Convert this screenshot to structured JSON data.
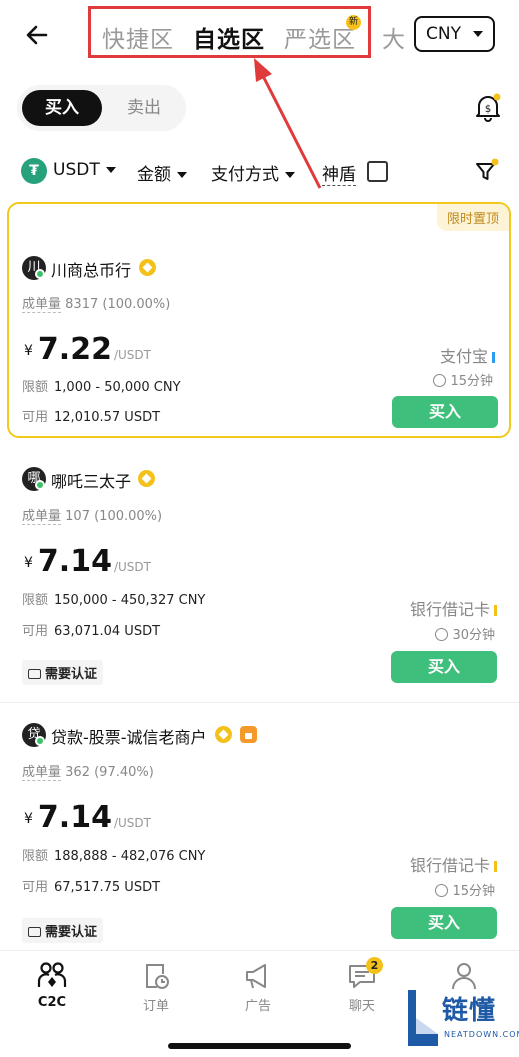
{
  "header": {
    "zone_tabs": [
      {
        "label": "快捷区"
      },
      {
        "label": "自选区"
      },
      {
        "label": "严选区"
      }
    ],
    "new_badge": "新",
    "zone_more": "大",
    "currency": "CNY"
  },
  "trade_toggle": {
    "buy": "买入",
    "sell": "卖出"
  },
  "filters": {
    "coin": "USDT",
    "coin_icon": "₮",
    "amount": "金额",
    "payment": "支付方式",
    "shield": "神盾"
  },
  "listings": [
    {
      "pinned": true,
      "pin_tag": "限时置顶",
      "avatar": "川",
      "merchant": "川商总币行",
      "trades_label": "成单量",
      "trades_value": "8317 (100.00%)",
      "yen": "¥",
      "price": "7.22",
      "unit": "/USDT",
      "limit_label": "限额",
      "limit_value": "1,000 - 50,000 CNY",
      "avail_label": "可用",
      "avail_value": "12,010.57 USDT",
      "payment": "支付宝",
      "payment_color": "#2d9cf0",
      "time": "15分钟",
      "buy": "买入"
    },
    {
      "pinned": false,
      "avatar": "哪",
      "merchant": "哪吒三太子",
      "trades_label": "成单量",
      "trades_value": "107 (100.00%)",
      "yen": "¥",
      "price": "7.14",
      "unit": "/USDT",
      "limit_label": "限额",
      "limit_value": "150,000 - 450,327 CNY",
      "avail_label": "可用",
      "avail_value": "63,071.04 USDT",
      "payment": "银行借记卡",
      "payment_color": "#f3c11a",
      "time": "30分钟",
      "kyc": "需要认证",
      "buy": "买入"
    },
    {
      "pinned": false,
      "avatar": "贷",
      "merchant": "贷款-股票-诚信老商户",
      "trades_label": "成单量",
      "trades_value": "362 (97.40%)",
      "yen": "¥",
      "price": "7.14",
      "unit": "/USDT",
      "limit_label": "限额",
      "limit_value": "188,888 - 482,076 CNY",
      "avail_label": "可用",
      "avail_value": "67,517.75 USDT",
      "payment": "银行借记卡",
      "payment_color": "#f3c11a",
      "time": "15分钟",
      "kyc": "需要认证",
      "buy": "买入"
    }
  ],
  "bottom_nav": [
    {
      "label": "C2C",
      "icon": "c2c-icon",
      "active": true
    },
    {
      "label": "订单",
      "icon": "order-icon"
    },
    {
      "label": "广告",
      "icon": "megaphone-icon"
    },
    {
      "label": "聊天",
      "icon": "chat-icon",
      "badge": "2"
    },
    {
      "label": "",
      "icon": "profile-icon"
    }
  ],
  "watermark": {
    "text": "链懂",
    "sub": "NEATDOWN.COM"
  },
  "colors": {
    "accent_green": "#3ebf7b",
    "pin_border": "#f1c91a",
    "highlight_red": "#e03a3a"
  }
}
